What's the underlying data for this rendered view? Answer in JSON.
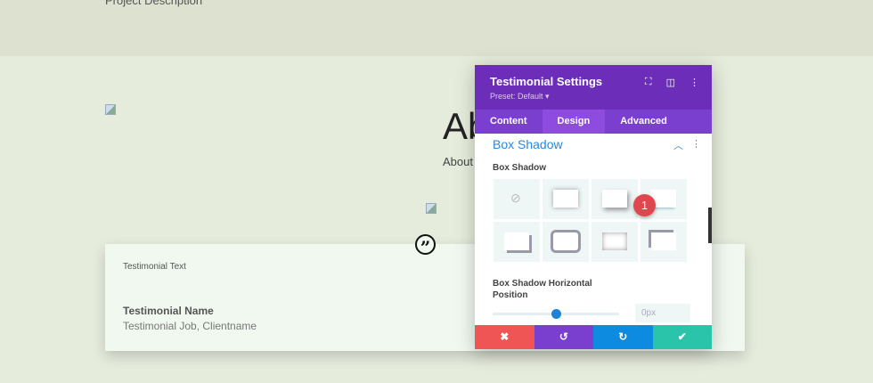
{
  "page": {
    "project_description": "Project Description",
    "heading": "About",
    "about_text": "About"
  },
  "testimonial": {
    "text": "Testimonial Text",
    "name": "Testimonial Name",
    "job": "Testimonial Job, Clientname"
  },
  "panel": {
    "title": "Testimonial Settings",
    "preset": "Preset: Default ▾",
    "tabs": [
      "Content",
      "Design",
      "Advanced"
    ],
    "active_tab": "Design",
    "section_title": "Box Shadow",
    "box_shadow_label": "Box Shadow",
    "horizontal_label_1": "Box Shadow Horizontal",
    "horizontal_label_2": "Position",
    "horizontal_value": "0px",
    "slider_fraction": 0.5
  },
  "badge": "1",
  "colors": {
    "header": "#6c2eb9",
    "tabs": "#7b3fd0",
    "cancel": "#ef5555",
    "undo": "#7b3fd0",
    "redo": "#0c8be0",
    "save": "#29c4a9"
  }
}
